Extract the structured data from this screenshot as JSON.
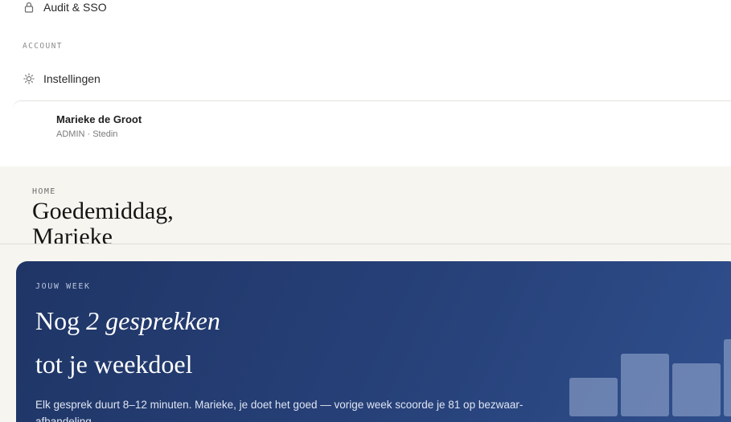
{
  "sidebar": {
    "items": [
      {
        "label": "Audit & SSO",
        "icon": "lock-icon"
      },
      {
        "label": "Instellingen",
        "icon": "sun-icon"
      }
    ],
    "section_label": "ACCOUNT",
    "user": {
      "name": "Marieke de Groot",
      "meta": "ADMIN · Stedin"
    }
  },
  "header": {
    "breadcrumb": "HOME",
    "title": "Goedemiddag, Marieke"
  },
  "week_card": {
    "eyebrow": "JOUW WEEK",
    "line1_prefix": "Nog",
    "line1_emphasis": "2 gesprekken",
    "line2": "tot je weekdoel",
    "description": "Elk gesprek duurt 8–12 minuten. Marieke, je doet het goed — vorige week scoorde je 81 op bezwaar-afhandeling.",
    "bar_color": "#9eb0d6"
  }
}
